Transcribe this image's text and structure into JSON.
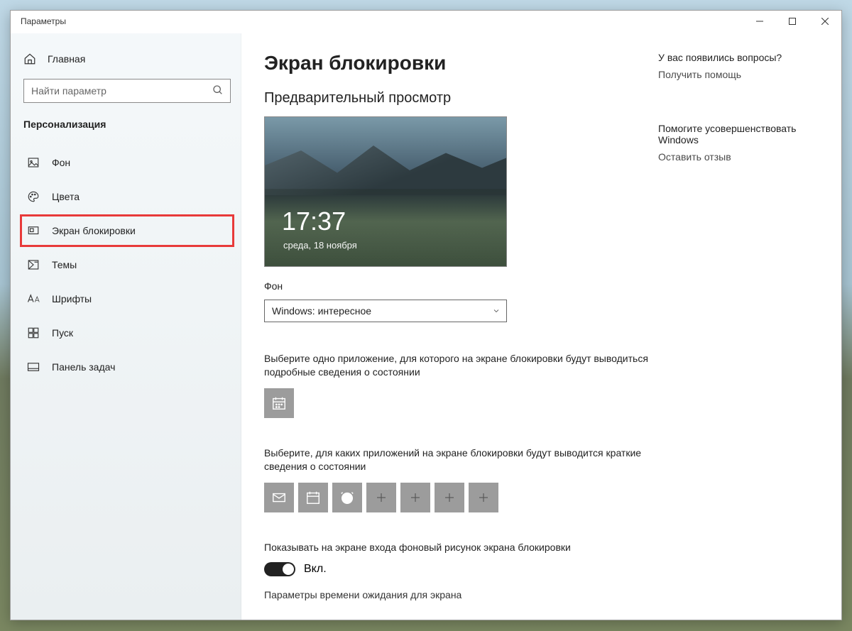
{
  "window": {
    "app_title": "Параметры"
  },
  "sidebar": {
    "home": "Главная",
    "search_placeholder": "Найти параметр",
    "section": "Персонализация",
    "items": [
      {
        "label": "Фон"
      },
      {
        "label": "Цвета"
      },
      {
        "label": "Экран блокировки"
      },
      {
        "label": "Темы"
      },
      {
        "label": "Шрифты"
      },
      {
        "label": "Пуск"
      },
      {
        "label": "Панель задач"
      }
    ]
  },
  "main": {
    "title": "Экран блокировки",
    "preview_heading": "Предварительный просмотр",
    "preview_time": "17:37",
    "preview_date": "среда, 18 ноября",
    "bg_label": "Фон",
    "bg_value": "Windows: интересное",
    "detailed_app_label": "Выберите одно приложение, для которого на экране блокировки будут выводиться подробные сведения о состоянии",
    "quick_apps_label": "Выберите, для каких приложений на экране блокировки будут выводится краткие сведения о состоянии",
    "signin_bg_label": "Показывать на экране входа фоновый рисунок экрана блокировки",
    "toggle_value": "Вкл.",
    "timeout_label": "Параметры времени ожидания для экрана"
  },
  "right": {
    "questions_title": "У вас появились вопросы?",
    "get_help": "Получить помощь",
    "improve_title": "Помогите усовершенствовать Windows",
    "feedback": "Оставить отзыв"
  }
}
